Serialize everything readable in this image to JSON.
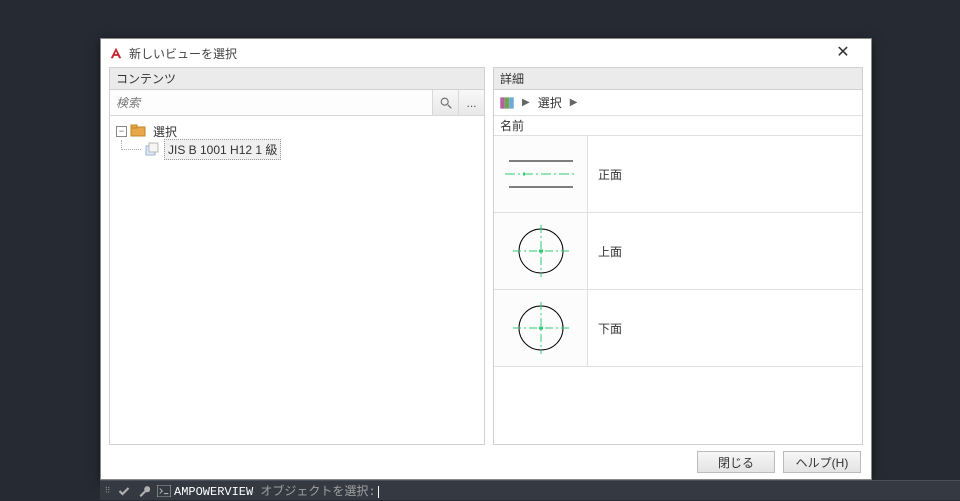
{
  "dialog": {
    "title": "新しいビューを選択",
    "close_label": "✕",
    "buttons": {
      "close": "閉じる",
      "help": "ヘルプ(H)"
    }
  },
  "left_panel": {
    "header": "コンテンツ",
    "search": {
      "placeholder": "検索",
      "more": "..."
    },
    "tree": {
      "root": {
        "label": "選択",
        "expanded": true
      },
      "child": {
        "label": "JIS B 1001 H12 1 級",
        "selected": true
      }
    }
  },
  "right_panel": {
    "header": "詳細",
    "breadcrumb": {
      "item": "選択"
    },
    "name_column": "名前",
    "views": [
      {
        "name": "正面",
        "thumb": "front"
      },
      {
        "name": "上面",
        "thumb": "circle"
      },
      {
        "name": "下面",
        "thumb": "circle"
      }
    ]
  },
  "cmd": {
    "command": "AMPOWERVIEW",
    "prompt": " オブジェクトを選択:"
  }
}
